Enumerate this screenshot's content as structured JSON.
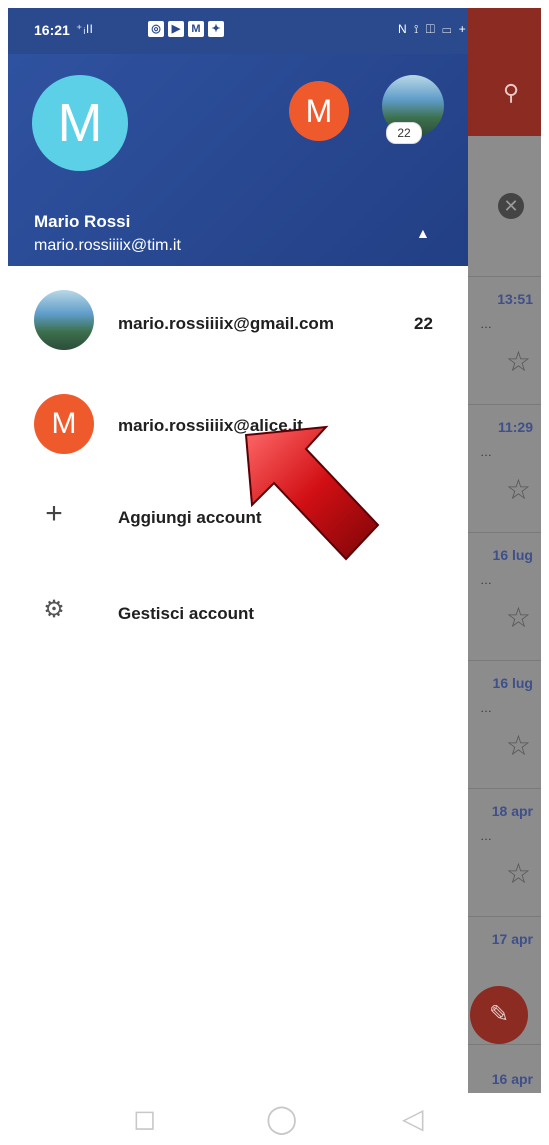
{
  "status_bar": {
    "time": "16:21",
    "signal": "⁺ᵢll",
    "app_badges": [
      "◎",
      "▶",
      "M",
      "✦"
    ],
    "right_icons": "N ⟟ ◫ ▭ +"
  },
  "background": {
    "search_icon": "search-icon",
    "rows": [
      {
        "time": "13:51"
      },
      {
        "time": "11:29"
      },
      {
        "time": "16 lug"
      },
      {
        "time": "16 lug"
      },
      {
        "time": "18 apr"
      },
      {
        "time": "17 apr"
      },
      {
        "time": "16 apr"
      }
    ]
  },
  "drawer": {
    "current_account": {
      "avatar_letter": "M",
      "name": "Mario Rossi",
      "email": "mario.rossiiiix@tim.it"
    },
    "header_avatars": [
      {
        "letter": "M"
      },
      {
        "badge": "22"
      }
    ],
    "accounts": [
      {
        "email": "mario.rossiiiix@gmail.com",
        "count": "22"
      },
      {
        "avatar_letter": "M",
        "email": "mario.rossiiiix@alice.it"
      }
    ],
    "actions": [
      {
        "icon": "plus-icon",
        "glyph": "+",
        "label": "Aggiungi account"
      },
      {
        "icon": "gear-icon",
        "glyph": "⚙",
        "label": "Gestisci account"
      }
    ]
  },
  "colors": {
    "header_blue": "#2b4a8d",
    "avatar_cyan": "#5bd0e6",
    "avatar_orange": "#ef5a2d",
    "arrow_red": "#b40d12"
  }
}
